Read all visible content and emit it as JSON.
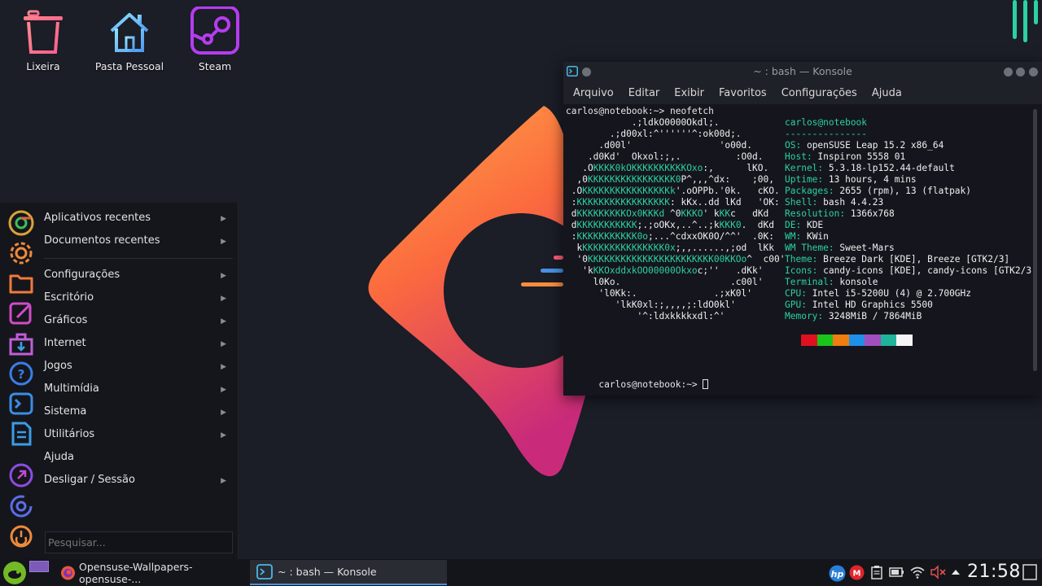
{
  "desktop": {
    "icons": [
      {
        "label": "Lixeira",
        "icon": "trash-icon"
      },
      {
        "label": "Pasta Pessoal",
        "icon": "home-folder-icon"
      },
      {
        "label": "Steam",
        "icon": "steam-icon"
      }
    ]
  },
  "konsole": {
    "title": "~ : bash — Konsole",
    "menu": [
      "Arquivo",
      "Editar",
      "Exibir",
      "Favoritos",
      "Configurações",
      "Ajuda"
    ],
    "prompt_line": "carlos@notebook:~> neofetch",
    "logo": [
      "            .;ldkO0000Okdl;.",
      "        .;d00xl:^''''''^:ok00d;.",
      "      .d00l'                'o00d.",
      "    .d0Kd'  Okxol:;,.          :O0d.",
      "   .OKKKK0kOKKKKKKKKKKOxo:,      lKO.",
      "  ,0KKKKKKKKKKKKKKKK0P^,,,^dx:    ;00,",
      " .OKKKKKKKKKKKKKKKKk'.oOPPb.'0k.   cKO.",
      " :KKKKKKKKKKKKKKKKK: kKx..dd lKd   'OK:",
      " dKKKKKKKKKOx0KKKd ^0KKKO' kKKc   dKd",
      " dKKKKKKKKKKK;.;oOKx,..^..;kKKK0.  dKd",
      " :KKKKKKKKKKK0o;...^cdxxOK0O/^^'  .0K:",
      "  kKKKKKKKKKKKKKKK0x;,,......,;od  lKk",
      "  '0KKKKKKKKKKKKKKKKKKKKKKK00KKOo^  c00'",
      "   'kKKOxddxkOO00000Okxoc;''   .dKk'",
      "     l0Ko.                    .c00l'",
      "      'l0Kk:.              .;xK0l'",
      "         'lkK0xl:;,,,,;:ldO0kl'",
      "             '^:ldxkkkkxdl:^'"
    ],
    "info": [
      {
        "key": "",
        "value": "carlos@notebook",
        "type": "header"
      },
      {
        "key": "",
        "value": "---------------",
        "type": "sep"
      },
      {
        "key": "OS",
        "value": "openSUSE Leap 15.2 x86_64"
      },
      {
        "key": "Host",
        "value": "Inspiron 5558 01"
      },
      {
        "key": "Kernel",
        "value": "5.3.18-lp152.44-default"
      },
      {
        "key": "Uptime",
        "value": "13 hours, 4 mins"
      },
      {
        "key": "Packages",
        "value": "2655 (rpm), 13 (flatpak)"
      },
      {
        "key": "Shell",
        "value": "bash 4.4.23"
      },
      {
        "key": "Resolution",
        "value": "1366x768"
      },
      {
        "key": "DE",
        "value": "KDE"
      },
      {
        "key": "WM",
        "value": "KWin"
      },
      {
        "key": "WM Theme",
        "value": "Sweet-Mars"
      },
      {
        "key": "Theme",
        "value": "Breeze Dark [KDE], Breeze [GTK2/3]"
      },
      {
        "key": "Icons",
        "value": "candy-icons [KDE], candy-icons [GTK2/3"
      },
      {
        "key": "Terminal",
        "value": "konsole"
      },
      {
        "key": "CPU",
        "value": "Intel i5-5200U (4) @ 2.700GHz"
      },
      {
        "key": "GPU",
        "value": "Intel HD Graphics 5500"
      },
      {
        "key": "Memory",
        "value": "3248MiB / 7864MiB"
      }
    ],
    "palette": [
      "#e01020",
      "#19c51a",
      "#f07d10",
      "#1e90e8",
      "#a04fc0",
      "#1eb59a",
      "#f5f5f5"
    ],
    "final_prompt": "carlos@notebook:~> "
  },
  "startmenu": {
    "items": [
      {
        "label": "Aplicativos recentes",
        "submenu": true
      },
      {
        "label": "Documentos recentes",
        "submenu": true
      },
      {
        "label": "Configurações",
        "submenu": true
      },
      {
        "label": "Escritório",
        "submenu": true
      },
      {
        "label": "Gráficos",
        "submenu": true
      },
      {
        "label": "Internet",
        "submenu": true
      },
      {
        "label": "Jogos",
        "submenu": true
      },
      {
        "label": "Multimídia",
        "submenu": true
      },
      {
        "label": "Sistema",
        "submenu": true
      },
      {
        "label": "Utilitários",
        "submenu": true
      },
      {
        "label": "Ajuda",
        "submenu": false
      },
      {
        "label": "Desligar / Sessão",
        "submenu": true
      }
    ],
    "search_placeholder": "Pesquisar..."
  },
  "taskbar": {
    "tasks": [
      {
        "label": "Opensuse-Wallpapers-opensuse-...",
        "icon": "firefox-icon"
      },
      {
        "label": "~ : bash — Konsole",
        "icon": "terminal-icon"
      }
    ],
    "clock": "21:58"
  },
  "colors": {
    "accent_green": "#2bd1a0",
    "menu_bg": "#15161c",
    "wallpaper_orange": "#fb8c3c",
    "wallpaper_pink": "#e8356a"
  }
}
